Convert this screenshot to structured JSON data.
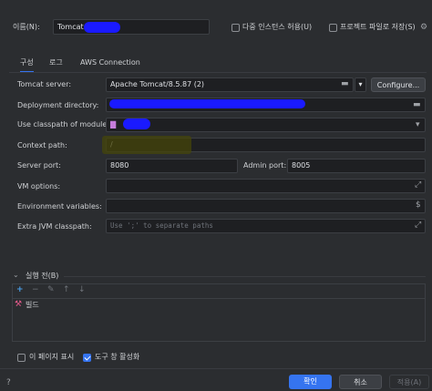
{
  "header": {
    "name_label": "이름(N):",
    "name_value": "Tomcat",
    "multi_instance_label": "다중 인스턴스 허용(U)",
    "save_project_label": "프로젝트 파일로 저장(S)"
  },
  "tabs": [
    "구성",
    "로그",
    "AWS Connection"
  ],
  "form": {
    "tomcat_server_label": "Tomcat server:",
    "tomcat_server_value": "Apache Tomcat/8.5.87 (2)",
    "configure_label": "Configure...",
    "deployment_label": "Deployment directory:",
    "classpath_label": "Use classpath of module:",
    "context_path_label": "Context path:",
    "context_path_value": "/",
    "server_port_label": "Server port:",
    "server_port_value": "8080",
    "admin_port_label": "Admin port:",
    "admin_port_value": "8005",
    "vm_options_label": "VM options:",
    "env_vars_label": "Environment variables:",
    "extra_classpath_label": "Extra JVM classpath:",
    "extra_classpath_placeholder": "Use ';' to separate paths"
  },
  "before_launch": {
    "title": "실행 전(B)",
    "item": "빌드"
  },
  "footer": {
    "show_page_label": "이 페이지 표시",
    "activate_tool_label": "도구 창 활성화",
    "ok_label": "확인",
    "cancel_label": "취소",
    "apply_label": "적용(A)"
  },
  "colors": {
    "accent": "#3574f0",
    "background": "#2b2d30",
    "field": "#1e1f22",
    "highlight": "#3b3a10"
  }
}
